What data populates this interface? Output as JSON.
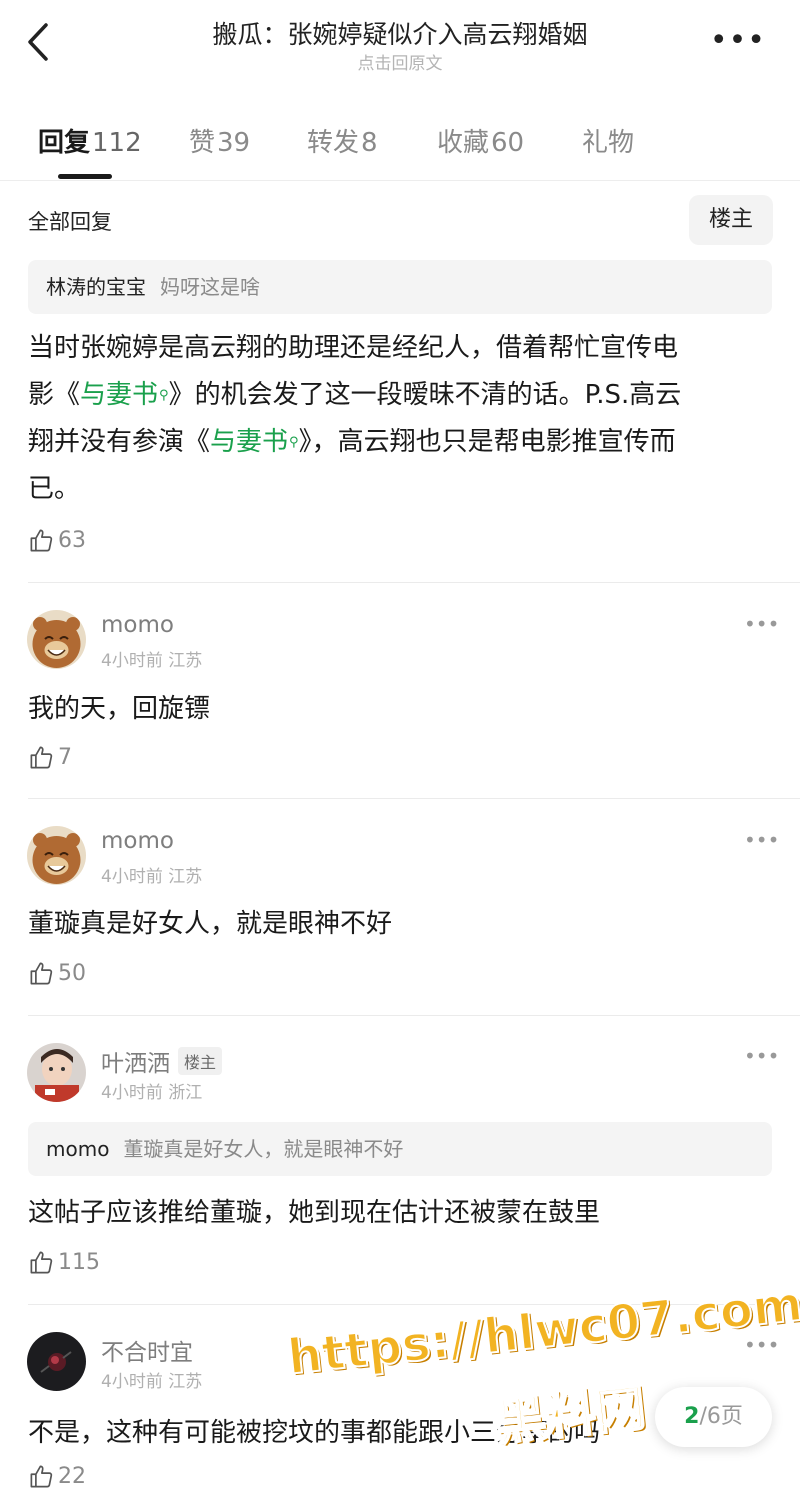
{
  "header": {
    "title": "搬瓜：张婉婷疑似介入高云翔婚姻",
    "subtitle": "点击回原文"
  },
  "tabs": [
    {
      "label": "回复",
      "count": "112"
    },
    {
      "label": "赞",
      "count": "39"
    },
    {
      "label": "转发",
      "count": "8"
    },
    {
      "label": "收藏",
      "count": "60"
    },
    {
      "label": "礼物",
      "count": ""
    }
  ],
  "filter": {
    "all_replies": "全部回复",
    "louzhu": "楼主"
  },
  "top_reply": {
    "quote_name": "林涛的宝宝",
    "quote_text": "妈呀这是啥",
    "text_1": "当时张婉婷是高云翔的助理还是经纪人，借着帮忙宣传电",
    "text_2a": "影《",
    "link_1": "与妻书",
    "text_2b": "》的机会发了这一段暧昧不清的话。P.S.高云",
    "text_3a": "翔并没有参演《",
    "link_2": "与妻书",
    "text_3b": "》，高云翔也只是帮电影推宣传而",
    "text_4": "已。",
    "likes": "63"
  },
  "comments": [
    {
      "name": "momo",
      "badge": "",
      "time": "4小时前",
      "location": "江苏",
      "text": "我的天，回旋镖",
      "likes": "7"
    },
    {
      "name": "momo",
      "badge": "",
      "time": "4小时前",
      "location": "江苏",
      "text": "董璇真是好女人，就是眼神不好",
      "likes": "50"
    },
    {
      "name": "叶洒洒",
      "badge": "楼主",
      "time": "4小时前",
      "location": "浙江",
      "quote_name": "momo",
      "quote_text": "董璇真是好女人，就是眼神不好",
      "text": "这帖子应该推给董璇，她到现在估计还被蒙在鼓里",
      "likes": "115"
    },
    {
      "name": "不合时宜",
      "badge": "",
      "time": "4小时前",
      "location": "江苏",
      "text": "不是，这种有可能被挖坟的事都能跟小三分享的吗",
      "likes": "22"
    }
  ],
  "pager": {
    "current": "2",
    "total": "/6页"
  },
  "watermark": {
    "line1": "https://hlwc07.com",
    "line2": "黑料网"
  },
  "colors": {
    "link": "#1aa04c",
    "watermark": "#f2b322"
  }
}
